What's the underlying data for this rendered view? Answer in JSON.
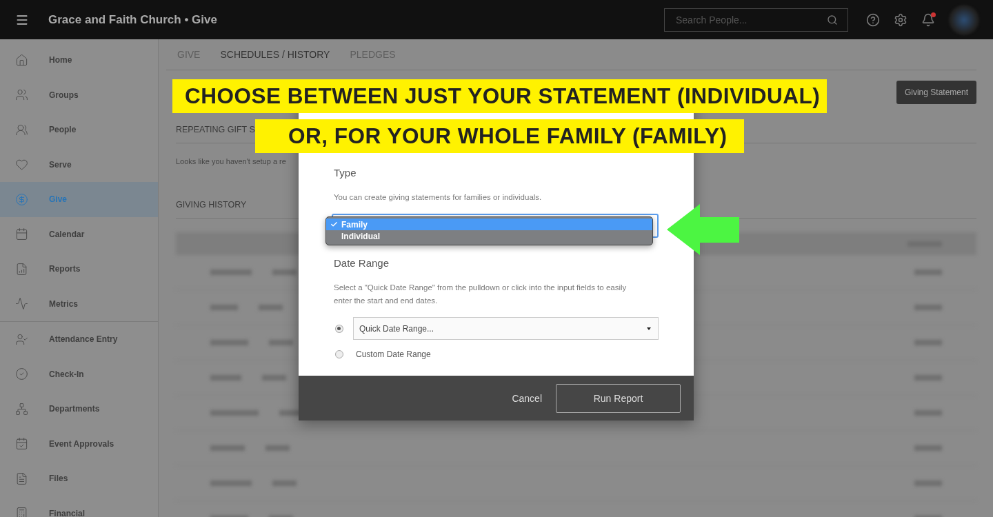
{
  "top_bar": {
    "title": "Grace and Faith Church • Give",
    "search": {
      "placeholder": "Search People..."
    },
    "notification_unread": true
  },
  "sidebar": {
    "groups": [
      {
        "items": [
          {
            "label": "Home",
            "selected": false
          },
          {
            "label": "Groups",
            "selected": false
          },
          {
            "label": "People",
            "selected": false
          },
          {
            "label": "Serve",
            "selected": false
          },
          {
            "label": "Give",
            "selected": true
          },
          {
            "label": "Calendar",
            "selected": false
          },
          {
            "label": "Reports",
            "selected": false
          },
          {
            "label": "Metrics",
            "selected": false
          }
        ]
      },
      {
        "items": [
          {
            "label": "Attendance Entry",
            "selected": false
          },
          {
            "label": "Check-In",
            "selected": false
          },
          {
            "label": "Departments",
            "selected": false
          },
          {
            "label": "Event Approvals",
            "selected": false
          },
          {
            "label": "Files",
            "selected": false
          },
          {
            "label": "Financial",
            "selected": false
          }
        ]
      }
    ]
  },
  "tabs": [
    {
      "label": "GIVE",
      "selected": false
    },
    {
      "label": "SCHEDULES / HISTORY",
      "selected": true
    },
    {
      "label": "PLEDGES",
      "selected": false
    }
  ],
  "statement_button": "Giving Statement",
  "repeating_gifts": {
    "heading": "REPEATING GIFT S",
    "text": "Looks like you haven't setup a re"
  },
  "giving_history": {
    "heading": "GIVING HISTORY"
  },
  "modal": {
    "type_heading": "Type",
    "type_text": "You can create giving statements for families or individuals.",
    "type_options": [
      {
        "label": "Family",
        "selected": true
      },
      {
        "label": "Individual",
        "selected": false
      }
    ],
    "date_heading": "Date Range",
    "date_text": "Select a \"Quick Date Range\" from the pulldown or click into the input fields to easily enter the start and end dates.",
    "date_choices": [
      {
        "kind": "select",
        "label": "Quick Date Range...",
        "selected": true
      },
      {
        "kind": "text",
        "label": "Custom Date Range",
        "selected": false
      }
    ],
    "cancel": "Cancel",
    "submit": "Run Report"
  },
  "banners": [
    "CHOOSE BETWEEN JUST YOUR STATEMENT (INDIVIDUAL)",
    "OR, FOR YOUR WHOLE FAMILY (FAMILY)"
  ]
}
